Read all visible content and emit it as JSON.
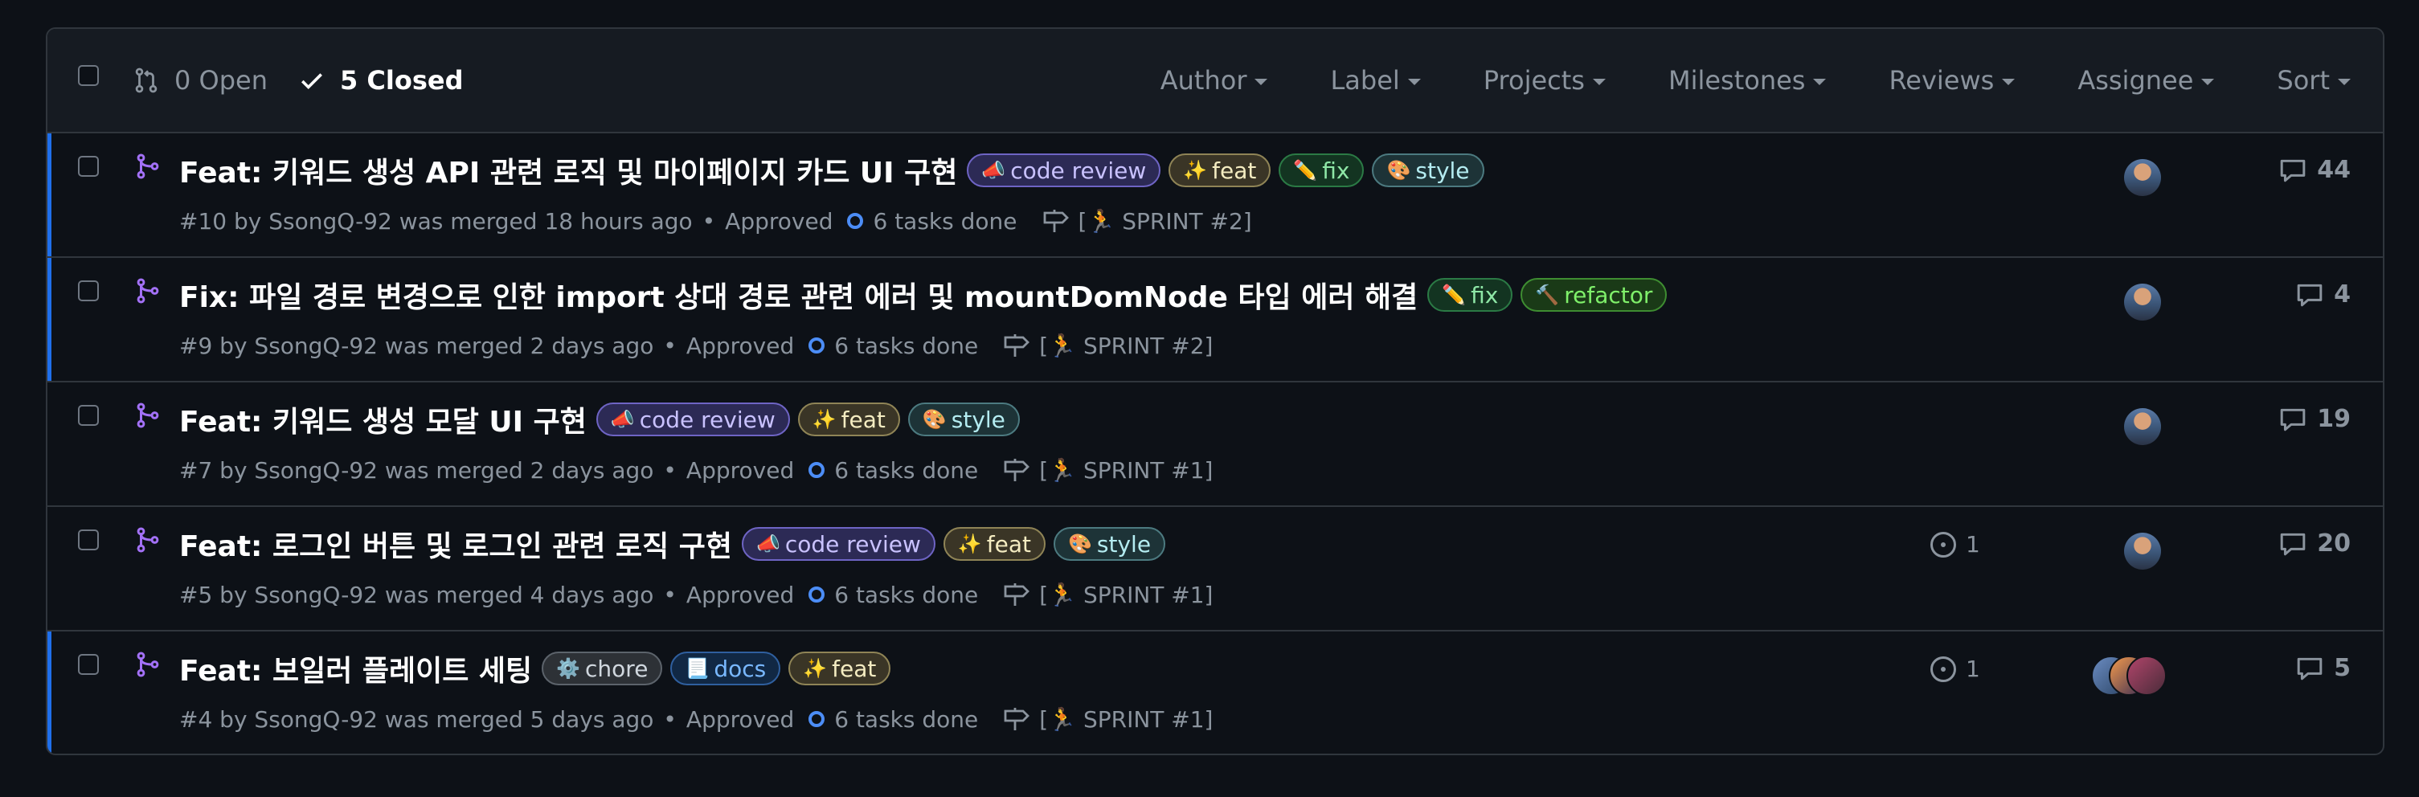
{
  "header": {
    "open_count": "0 Open",
    "closed_count": "5 Closed",
    "filters": [
      "Author",
      "Label",
      "Projects",
      "Milestones",
      "Reviews",
      "Assignee",
      "Sort"
    ]
  },
  "colors": {
    "merged": "#a371f7",
    "unread": "#1f6feb",
    "tasks_ring": "#4c8df6"
  },
  "prs": [
    {
      "title": "Feat: 키워드 생성 API 관련 로직 및 마이페이지 카드 UI 구현",
      "labels": [
        {
          "class": "code-review",
          "icon": "📣",
          "text": "code review"
        },
        {
          "class": "feat",
          "icon": "✨",
          "text": "feat"
        },
        {
          "class": "fix",
          "icon": "✏️",
          "text": "fix"
        },
        {
          "class": "style",
          "icon": "🎨",
          "text": "style"
        }
      ],
      "meta": "#10 by SsongQ-92 was merged 18 hours ago",
      "review": "Approved",
      "tasks": "6 tasks done",
      "milestone": "[🏃 SPRINT #2]",
      "linked_issues": "",
      "comments": "44"
    },
    {
      "title": "Fix: 파일 경로 변경으로 인한 import 상대 경로 관련 에러 및 mountDomNode 타입 에러 해결",
      "labels": [
        {
          "class": "fix",
          "icon": "✏️",
          "text": "fix"
        },
        {
          "class": "refactor",
          "icon": "🔨",
          "text": "refactor"
        }
      ],
      "meta": "#9 by SsongQ-92 was merged 2 days ago",
      "review": "Approved",
      "tasks": "6 tasks done",
      "milestone": "[🏃 SPRINT #2]",
      "linked_issues": "",
      "comments": "4"
    },
    {
      "title": "Feat: 키워드 생성 모달 UI 구현",
      "labels": [
        {
          "class": "code-review",
          "icon": "📣",
          "text": "code review"
        },
        {
          "class": "feat",
          "icon": "✨",
          "text": "feat"
        },
        {
          "class": "style",
          "icon": "🎨",
          "text": "style"
        }
      ],
      "meta": "#7 by SsongQ-92 was merged 2 days ago",
      "review": "Approved",
      "tasks": "6 tasks done",
      "milestone": "[🏃 SPRINT #1]",
      "linked_issues": "",
      "comments": "19"
    },
    {
      "title": "Feat: 로그인 버튼 및 로그인 관련 로직 구현",
      "labels": [
        {
          "class": "code-review",
          "icon": "📣",
          "text": "code review"
        },
        {
          "class": "feat",
          "icon": "✨",
          "text": "feat"
        },
        {
          "class": "style",
          "icon": "🎨",
          "text": "style"
        }
      ],
      "meta": "#5 by SsongQ-92 was merged 4 days ago",
      "review": "Approved",
      "tasks": "6 tasks done",
      "milestone": "[🏃 SPRINT #1]",
      "linked_issues": "1",
      "comments": "20"
    },
    {
      "title": "Feat: 보일러 플레이트 세팅",
      "labels": [
        {
          "class": "chore",
          "icon": "⚙️",
          "text": "chore"
        },
        {
          "class": "docs",
          "icon": "📃",
          "text": "docs"
        },
        {
          "class": "feat",
          "icon": "✨",
          "text": "feat"
        }
      ],
      "meta": "#4 by SsongQ-92 was merged 5 days ago",
      "review": "Approved",
      "tasks": "6 tasks done",
      "milestone": "[🏃 SPRINT #1]",
      "linked_issues": "1",
      "comments": "5"
    }
  ]
}
